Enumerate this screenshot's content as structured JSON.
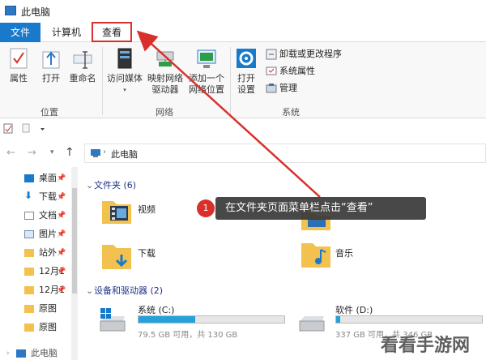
{
  "window": {
    "title": "此电脑"
  },
  "tabs": {
    "file": "文件",
    "computer": "计算机",
    "view": "查看"
  },
  "ribbon": {
    "location": {
      "properties": "属性",
      "open": "打开",
      "rename": "重命名",
      "group": "位置"
    },
    "network": {
      "access_media": "访问媒体",
      "map_drive_1": "映射网络",
      "map_drive_2": "驱动器",
      "add_location_1": "添加一个",
      "add_location_2": "网络位置",
      "group": "网络"
    },
    "system": {
      "open_settings_1": "打开",
      "open_settings_2": "设置",
      "uninstall": "卸载或更改程序",
      "sys_props": "系统属性",
      "manage": "管理",
      "group": "系统"
    }
  },
  "address": {
    "path": "此电脑"
  },
  "nav": {
    "items": [
      {
        "label": "桌面",
        "pinned": true
      },
      {
        "label": "下载",
        "pinned": true
      },
      {
        "label": "文档",
        "pinned": true
      },
      {
        "label": "图片",
        "pinned": true
      },
      {
        "label": "站外",
        "pinned": true
      },
      {
        "label": "12月1",
        "pinned": true
      },
      {
        "label": "12月1",
        "pinned": true
      },
      {
        "label": "原图",
        "pinned": false
      },
      {
        "label": "原图",
        "pinned": false
      }
    ],
    "this_pc": "此电脑"
  },
  "content": {
    "folders_header": "文件夹 (6)",
    "folders": [
      {
        "label": "视频"
      },
      {
        "label": "下载"
      },
      {
        "label": "音乐"
      }
    ],
    "drives_header": "设备和驱动器 (2)",
    "drives": [
      {
        "label": "系统 (C:)",
        "free_text": "79.5 GB 可用，共 130 GB",
        "used_fraction": 0.39
      },
      {
        "label": "软件 (D:)",
        "free_text": "337 GB 可用，共 346 GB",
        "used_fraction": 0.03
      }
    ]
  },
  "tooltip": {
    "step": "1",
    "text": "在文件夹页面菜单栏点击“查看”"
  },
  "watermark": "看看手游网",
  "colors": {
    "accent": "#1979ca",
    "highlight": "#d9302c",
    "drive_fill": "#26a0da"
  }
}
